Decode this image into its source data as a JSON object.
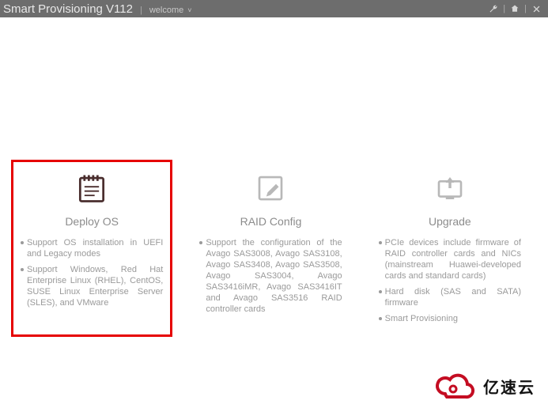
{
  "header": {
    "title": "Smart Provisioning V112",
    "welcome_label": "welcome"
  },
  "cards": {
    "deploy": {
      "title": "Deploy OS",
      "bullets": [
        "Support OS installation in UEFI and Legacy modes",
        "Support Windows, Red Hat Enterprise Linux (RHEL), CentOS, SUSE Linux Enterprise Server (SLES), and VMware"
      ]
    },
    "raid": {
      "title": "RAID Config",
      "bullets": [
        "Support the configuration of the Avago SAS3008, Avago SAS3108, Avago SAS3408, Avago SAS3508, Avago SAS3004, Avago SAS3416iMR, Avago SAS3416IT and Avago SAS3516 RAID controller cards"
      ]
    },
    "upgrade": {
      "title": "Upgrade",
      "bullets": [
        "PCIe devices include firmware of RAID controller cards and NICs (mainstream Huawei-developed cards and standard cards)",
        "Hard disk (SAS and SATA) firmware",
        "Smart Provisioning"
      ]
    }
  },
  "watermark": {
    "text": "亿速云"
  }
}
